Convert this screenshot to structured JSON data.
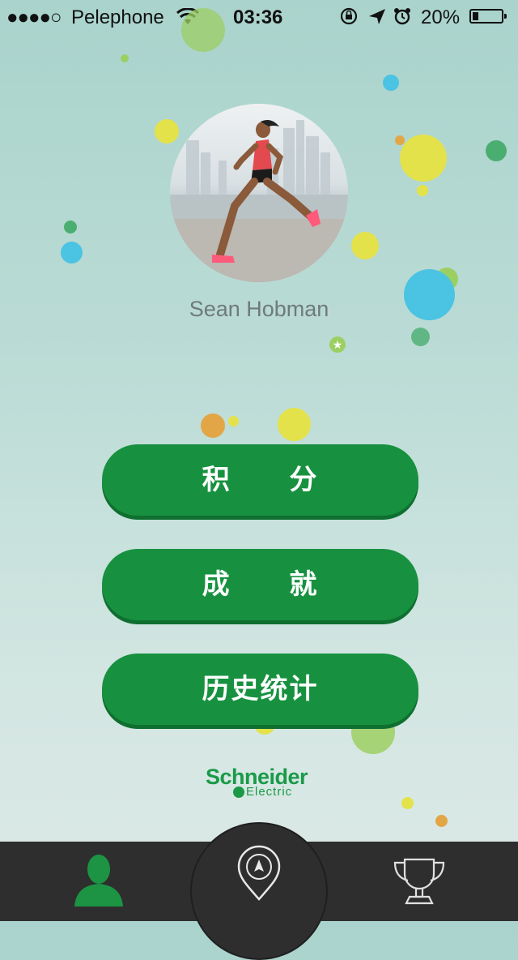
{
  "status_bar": {
    "signal": "●●●●○",
    "carrier": "Pelephone",
    "time": "03:36",
    "battery_percent": "20%",
    "battery_level": 0.2,
    "icons": [
      "wifi-icon",
      "rotation-lock-icon",
      "location-arrow-icon",
      "alarm-icon",
      "battery-icon"
    ]
  },
  "profile": {
    "name": "Sean Hobman",
    "avatar": "runner-photo"
  },
  "menu": {
    "points_label": "积 分",
    "achievements_label": "成 就",
    "history_label": "历史统计"
  },
  "brand": {
    "line1": "Schneider",
    "line2": "Electric"
  },
  "tabbar": {
    "tabs": [
      "profile-tab",
      "navigate-tab",
      "trophy-tab"
    ],
    "active": "profile-tab"
  },
  "colors": {
    "accent": "#17913f",
    "tabbar": "#2e2e2e",
    "bubble_yellow": "#e3e24a",
    "bubble_blue": "#4bc3e2",
    "bubble_green": "#4aae70",
    "bubble_lime": "#9ccf63",
    "bubble_orange": "#e3a646"
  }
}
